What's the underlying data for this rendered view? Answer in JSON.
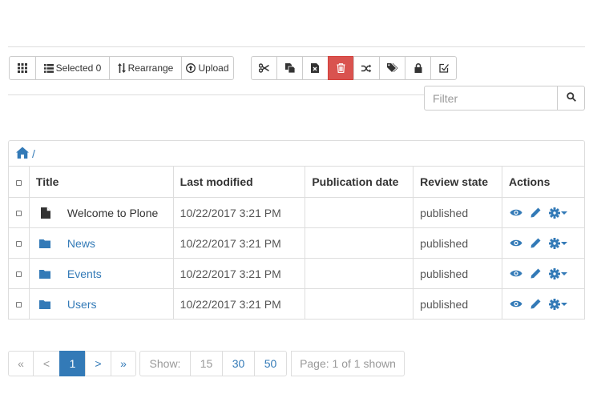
{
  "toolbar": {
    "grid_label": "",
    "selected_label": "Selected 0",
    "rearrange_label": "Rearrange",
    "upload_label": "Upload",
    "actions": [
      {
        "name": "cut-button",
        "icon": "scissors-icon"
      },
      {
        "name": "copy-button",
        "icon": "copy-icon"
      },
      {
        "name": "paste-button",
        "icon": "paste-icon"
      },
      {
        "name": "delete-button",
        "icon": "trash-icon"
      },
      {
        "name": "rename-button",
        "icon": "shuffle-icon"
      },
      {
        "name": "tags-button",
        "icon": "tags-icon"
      },
      {
        "name": "properties-button",
        "icon": "lock-icon"
      },
      {
        "name": "workflow-button",
        "icon": "edit-check-icon"
      }
    ]
  },
  "filter": {
    "placeholder": "Filter"
  },
  "breadcrumb": {
    "separator": "/"
  },
  "table": {
    "headers": {
      "title": "Title",
      "modified": "Last modified",
      "publication": "Publication date",
      "state": "Review state",
      "actions": "Actions"
    },
    "rows": [
      {
        "title": "Welcome to Plone",
        "type": "document",
        "modified": "10/22/2017 3:21 PM",
        "publication": "",
        "state": "published"
      },
      {
        "title": "News",
        "type": "folder",
        "modified": "10/22/2017 3:21 PM",
        "publication": "",
        "state": "published"
      },
      {
        "title": "Events",
        "type": "folder",
        "modified": "10/22/2017 3:21 PM",
        "publication": "",
        "state": "published"
      },
      {
        "title": "Users",
        "type": "folder",
        "modified": "10/22/2017 3:21 PM",
        "publication": "",
        "state": "published"
      }
    ]
  },
  "pagination": {
    "first": "«",
    "prev": "<",
    "current": "1",
    "next": ">",
    "last": "»",
    "show_label": "Show:",
    "sizes": [
      "15",
      "30",
      "50"
    ],
    "page_info": "Page: 1 of 1 shown"
  },
  "colors": {
    "accent": "#337ab7",
    "danger": "#d9534f",
    "border": "#dddddd"
  }
}
